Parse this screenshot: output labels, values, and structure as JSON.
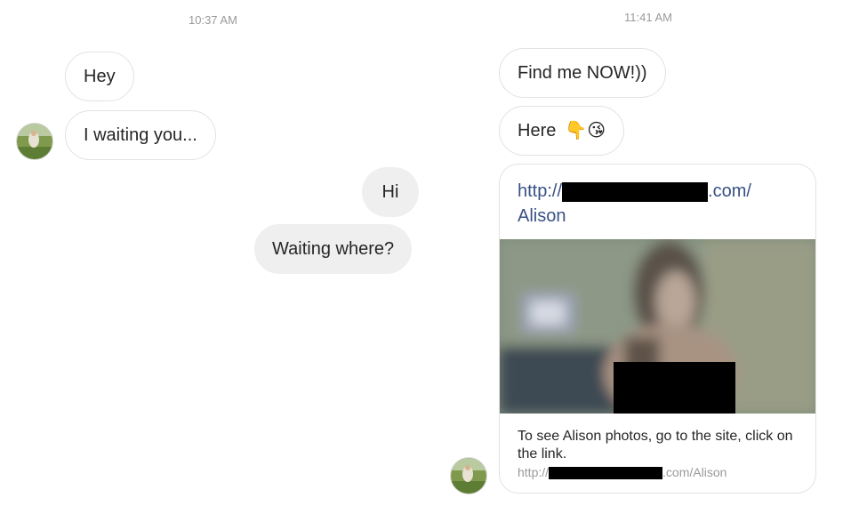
{
  "left_thread": {
    "timestamp": "10:37 AM",
    "messages": [
      {
        "text": "Hey",
        "from": "them"
      },
      {
        "text": "I waiting you...",
        "from": "them"
      },
      {
        "text": "Hi",
        "from": "me"
      },
      {
        "text": "Waiting where?",
        "from": "me"
      }
    ]
  },
  "right_thread": {
    "timestamp": "11:41 AM",
    "messages": [
      {
        "text": "Find me NOW!))",
        "from": "them"
      },
      {
        "text": "Here",
        "emojis": "👇😘",
        "from": "them"
      }
    ],
    "link_card": {
      "url_prefix": "http://",
      "url_suffix": ".com/",
      "url_path": "Alison",
      "description": "To see Alison photos, go to the site, click on the link.",
      "footer_prefix": "http://",
      "footer_suffix": ".com/Alison"
    }
  },
  "colors": {
    "incoming_border": "#e2e2e2",
    "outgoing_bg": "#efefef",
    "link": "#385185",
    "timestamp": "#9a9a9a",
    "redaction": "#000000"
  }
}
